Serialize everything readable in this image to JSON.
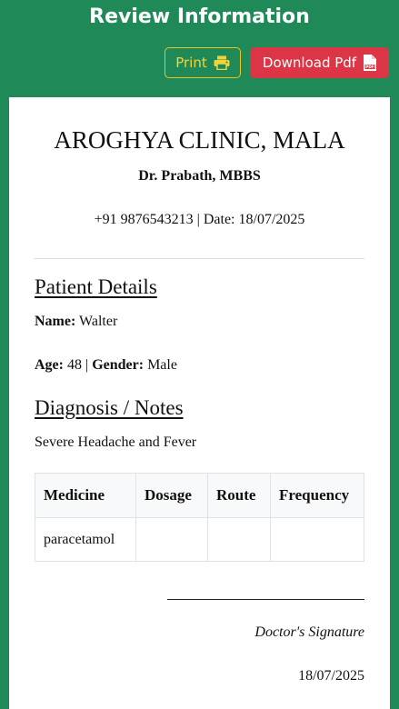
{
  "header": {
    "title": "Review Information"
  },
  "toolbar": {
    "print_label": "Print",
    "download_label": "Download Pdf",
    "print_icon": "printer-icon",
    "pdf_icon": "pdf-file-icon"
  },
  "clinic": {
    "name": "AROGHYA CLINIC, MALA",
    "doctor": "Dr. Prabath, MBBS",
    "phone": "+91 9876543213",
    "separator": " | ",
    "date_label": "Date:",
    "date": "18/07/2025"
  },
  "patient": {
    "heading": "Patient Details",
    "name_label": "Name:",
    "name": "Walter",
    "age_label": "Age:",
    "age": "48",
    "separator": " | ",
    "gender_label": "Gender:",
    "gender": "Male"
  },
  "diagnosis": {
    "heading": "Diagnosis / Notes",
    "text": "Severe Headache and Fever"
  },
  "medicines": {
    "columns": [
      "Medicine",
      "Dosage",
      "Route",
      "Frequency"
    ],
    "rows": [
      [
        "paracetamol",
        "",
        "",
        ""
      ]
    ]
  },
  "signature": {
    "label": "Doctor's Signature",
    "date": "18/07/2025"
  },
  "colors": {
    "background": "#1f8a57",
    "print_border": "#e6c52a",
    "pdf_button": "#dc3545"
  }
}
